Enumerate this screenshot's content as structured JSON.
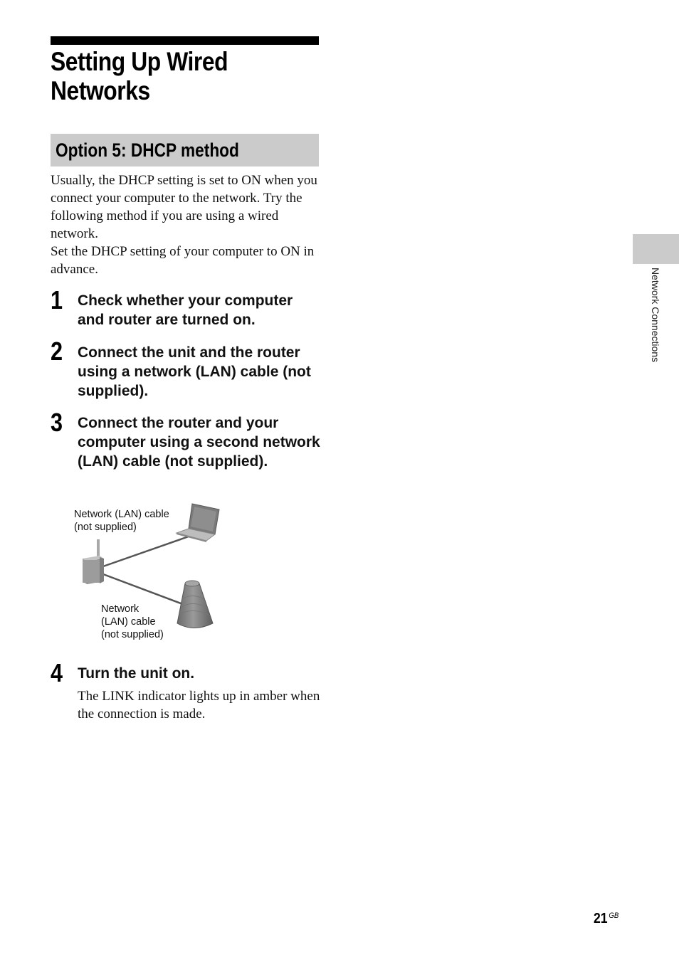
{
  "page": {
    "title_lines": [
      "Setting Up Wired",
      "Networks"
    ],
    "section_title": "Option 5: DHCP method",
    "intro_paragraphs": [
      "Usually, the DHCP setting is set to ON when you connect your computer to the network. Try the following method if you are using a wired network.",
      "Set the DHCP setting of your computer to ON in advance."
    ],
    "steps": [
      {
        "number": "1",
        "text": "Check whether your computer and router are turned on."
      },
      {
        "number": "2",
        "text": "Connect the unit and the router using a network (LAN) cable (not supplied)."
      },
      {
        "number": "3",
        "text": "Connect the router and your computer using a second network (LAN) cable (not supplied)."
      },
      {
        "number": "4",
        "text": "Turn the unit on.",
        "description": "The LINK indicator lights up in amber when the connection is made."
      }
    ],
    "diagram": {
      "label_top": [
        "Network (LAN) cable",
        "(not supplied)"
      ],
      "label_bottom": [
        "Network",
        "(LAN) cable",
        "(not supplied)"
      ],
      "devices": [
        "router-icon",
        "laptop-icon",
        "speaker-unit-icon"
      ]
    },
    "side_tab_label": "Network Connections",
    "page_number": "21",
    "page_suffix": "GB"
  }
}
